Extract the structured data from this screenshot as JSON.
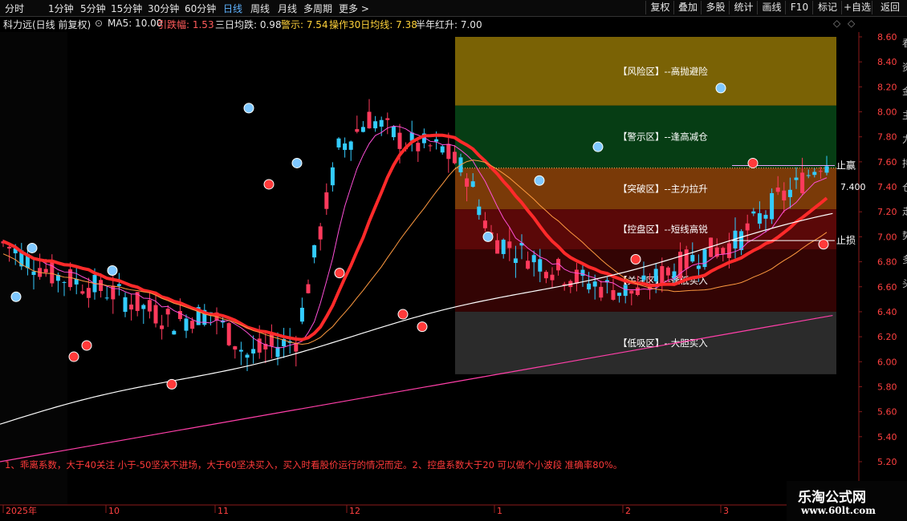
{
  "toolbar": {
    "tabs": [
      "分时",
      "1分钟",
      "5分钟",
      "15分钟",
      "30分钟",
      "60分钟",
      "日线",
      "周线",
      "月线",
      "多周期",
      "更多 >"
    ],
    "active_tab": "日线",
    "right_buttons": [
      "复权",
      "叠加",
      "多股",
      "统计",
      "画线",
      "F10",
      "标记",
      "+自选",
      "返回"
    ]
  },
  "info": {
    "stock_title": "科力远(日线 前复权)",
    "ma5": "MA5: 10.00",
    "yindiefu": "引跌幅: 1.53",
    "sanri": "三日均跌: 0.98",
    "jingshi": "警示: 7.54",
    "caozuo": "操作30日均线: 7.38",
    "bannian": "半年红升: 7.00"
  },
  "zones": [
    {
      "label": "【风险区】--高抛避险",
      "top": 8.6,
      "bottom": 8.05,
      "color": "#7a6205"
    },
    {
      "label": "【警示区】--逢高减仓",
      "top": 8.05,
      "bottom": 7.55,
      "color": "#063d14"
    },
    {
      "label": "【突破区】--主力拉升",
      "top": 7.55,
      "bottom": 7.22,
      "color": "#7a3a08"
    },
    {
      "label": "【控盘区】--短线高锐",
      "top": 7.22,
      "bottom": 6.9,
      "color": "#5a0808"
    },
    {
      "label": "【关注区】--逢低买入",
      "top": 6.9,
      "bottom": 6.4,
      "color": "#330404"
    },
    {
      "label": "【低吸区】--大胆买入",
      "top": 6.4,
      "bottom": 5.9,
      "color": "#2b2b2b"
    }
  ],
  "markers": {
    "stop_profit": "止赢",
    "stop_loss": "止损",
    "price_tag": "7.400"
  },
  "note": "1、乖离系数，大于40关注 小于-50坚决不进场，大于60坚决买入，买入时看股价运行的情况而定。2、控盘系数大于20 可以做个小波段 准确率80%。",
  "watermark": {
    "line1": "乐淘公式网",
    "line2": "www.60lt.com"
  },
  "side_partial_text": "看资金主力持仓走势多头",
  "chart_data": {
    "type": "candlestick",
    "y_axis_ticks": [
      8.6,
      8.4,
      8.2,
      8.0,
      7.8,
      7.6,
      7.4,
      7.2,
      7.0,
      6.8,
      6.6,
      6.4,
      6.2,
      6.0,
      5.8,
      5.6,
      5.4,
      5.2
    ],
    "x_axis_labels": [
      "2025年",
      "10",
      "11",
      "12",
      "1",
      "2",
      "3"
    ],
    "ylim": [
      5.1,
      8.7
    ],
    "colors": {
      "up": "#ff3a5c",
      "down": "#33ccff"
    }
  }
}
